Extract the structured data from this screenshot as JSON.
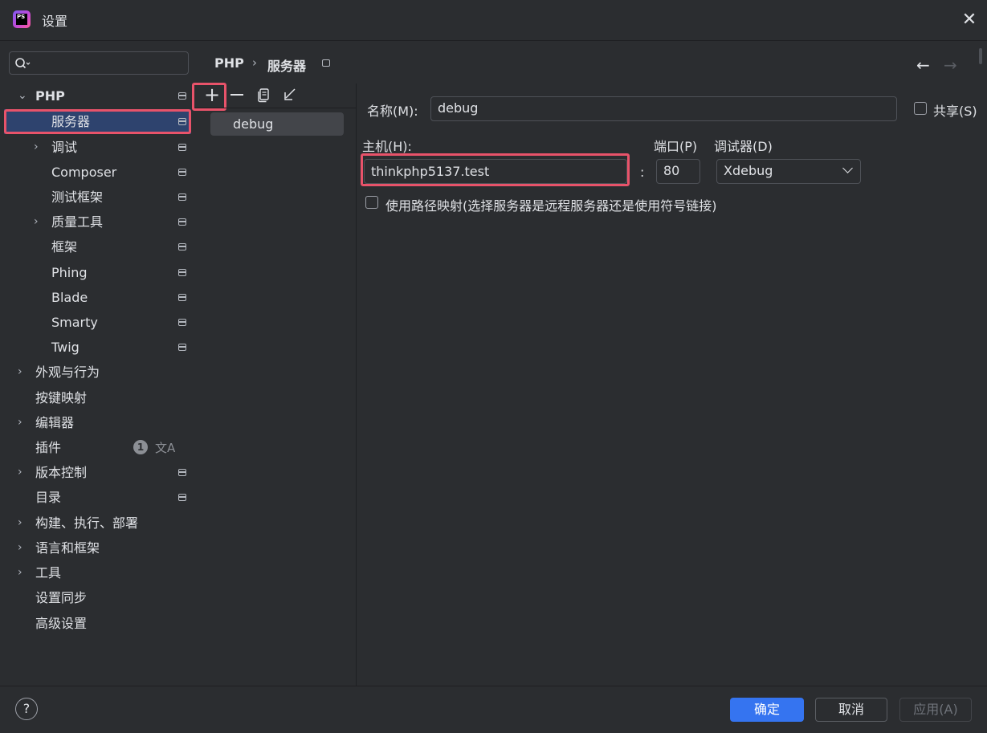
{
  "window": {
    "title": "设置",
    "close_icon": "close-icon",
    "logo_text": "PS"
  },
  "search": {
    "placeholder": "",
    "value": ""
  },
  "tree": {
    "items": [
      {
        "label": "PHP",
        "expanded": true,
        "bold": true
      },
      {
        "label": "服务器",
        "selected": true
      },
      {
        "label": "调试",
        "expandable": true
      },
      {
        "label": "Composer"
      },
      {
        "label": "测试框架"
      },
      {
        "label": "质量工具",
        "expandable": true
      },
      {
        "label": "框架"
      },
      {
        "label": "Phing"
      },
      {
        "label": "Blade"
      },
      {
        "label": "Smarty"
      },
      {
        "label": "Twig"
      },
      {
        "label": "外观与行为",
        "expandable": true
      },
      {
        "label": "按键映射"
      },
      {
        "label": "编辑器",
        "expandable": true
      },
      {
        "label": "插件",
        "badge": "1"
      },
      {
        "label": "版本控制",
        "expandable": true
      },
      {
        "label": "目录"
      },
      {
        "label": "构建、执行、部署",
        "expandable": true
      },
      {
        "label": "语言和框架",
        "expandable": true
      },
      {
        "label": "工具",
        "expandable": true
      },
      {
        "label": "设置同步"
      },
      {
        "label": "高级设置"
      }
    ]
  },
  "breadcrumb": {
    "root": "PHP",
    "separator": "›",
    "current": "服务器"
  },
  "nav": {
    "back": "←",
    "forward": "→"
  },
  "toolbar": {
    "add": "+",
    "remove": "—"
  },
  "servers": {
    "items": [
      "debug"
    ]
  },
  "form": {
    "name_label": "名称(M):",
    "name_value": "debug",
    "share_label": "共享(S)",
    "host_label": "主机(H):",
    "host_value": "thinkphp5137.test",
    "colon": ":",
    "port_label": "端口(P)",
    "port_value": "80",
    "debugger_label": "调试器(D)",
    "debugger_value": "Xdebug",
    "path_mapping_label": "使用路径映射(选择服务器是远程服务器还是使用符号链接)"
  },
  "footer": {
    "help": "?",
    "ok": "确定",
    "cancel": "取消",
    "apply": "应用(A)"
  },
  "colors": {
    "accent": "#3574f0",
    "highlight": "#e8536a",
    "selection": "#2e436e",
    "background": "#2b2d30"
  }
}
